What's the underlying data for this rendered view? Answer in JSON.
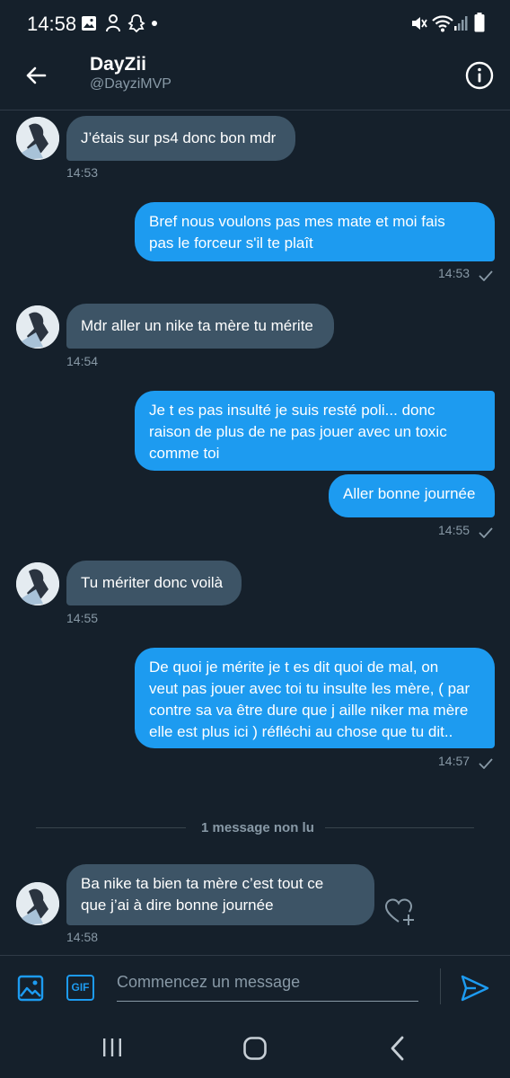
{
  "status_bar": {
    "time": "14:58"
  },
  "header": {
    "name": "DayZii",
    "handle": "@DayziMVP"
  },
  "messages": [
    {
      "direction": "in",
      "text": "J’étais sur ps4 donc bon mdr",
      "time": "14:53"
    },
    {
      "direction": "out",
      "lines": [
        "Bref nous voulons pas mes mate et moi fais",
        "pas le forceur s'il te plaît"
      ],
      "time": "14:53"
    },
    {
      "direction": "in",
      "text": "Mdr aller un nike ta mère tu mérite",
      "time": "14:54"
    },
    {
      "direction": "out",
      "lines": [
        "Je t es pas insulté je suis resté poli... donc",
        "raison de plus de ne pas jouer avec un toxic",
        "comme toi"
      ]
    },
    {
      "direction": "out",
      "text": "Aller bonne journée",
      "time": "14:55"
    },
    {
      "direction": "in",
      "text": "Tu mériter donc voilà",
      "time": "14:55"
    },
    {
      "direction": "out",
      "lines": [
        "De quoi je mérite je t es dit quoi de mal, on",
        "veut pas jouer avec toi tu insulte les mère, ( par",
        "contre sa va être dure que j aille niker ma mère",
        "elle est plus ici ) réfléchi au chose que tu dit.."
      ],
      "time": "14:57"
    },
    {
      "direction": "in",
      "lines": [
        "Ba nike ta bien ta mère c’est tout ce",
        "que j’ai à dire bonne journée"
      ],
      "time": "14:58"
    }
  ],
  "divider": {
    "label": "1 message non lu"
  },
  "composer": {
    "placeholder": "Commencez un message",
    "gif_label": "GIF"
  },
  "colors": {
    "background": "#15202b",
    "outgoing": "#1d9bf0",
    "incoming": "#3d5466",
    "muted": "#8899a6"
  }
}
